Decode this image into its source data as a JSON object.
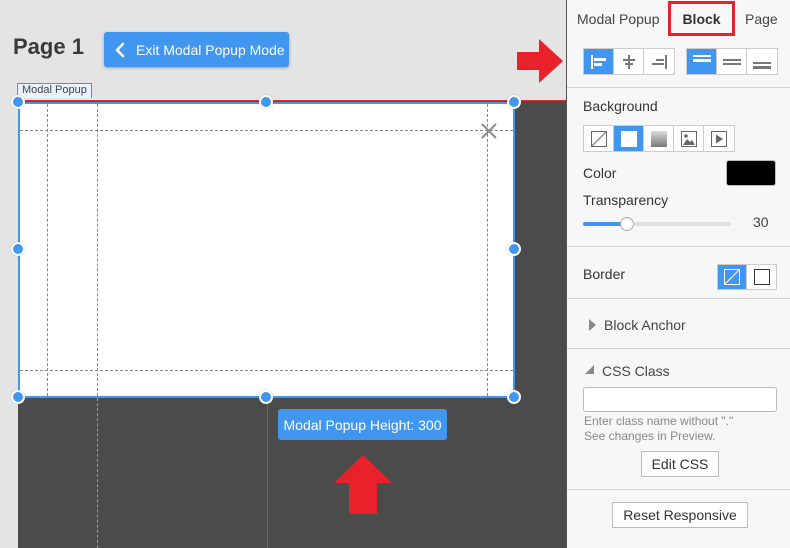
{
  "canvas": {
    "page_title": "Page 1",
    "exit_button_label": "Exit Modal Popup Mode",
    "modal_label": "Modal Popup",
    "height_tooltip": "Modal Popup Height: 300"
  },
  "panel": {
    "tabs": [
      {
        "label": "Modal Popup",
        "active": false
      },
      {
        "label": "Block",
        "active": true
      },
      {
        "label": "Page",
        "active": false
      }
    ],
    "horizontal_align": {
      "options": [
        "align-left-icon",
        "align-center-icon",
        "align-right-icon"
      ],
      "selected": "align-left-icon"
    },
    "vertical_align": {
      "options": [
        "align-top-icon",
        "align-middle-icon",
        "align-bottom-icon"
      ],
      "selected": "align-top-icon"
    },
    "background": {
      "label": "Background",
      "options": [
        "none-icon",
        "solid-color-icon",
        "gradient-icon",
        "image-icon",
        "video-icon"
      ],
      "selected": "solid-color-icon",
      "color_label": "Color",
      "color_value": "#000000",
      "transparency_label": "Transparency",
      "transparency_value": 30
    },
    "border": {
      "label": "Border",
      "options": [
        "no-border-icon",
        "border-box-icon"
      ],
      "selected": "no-border-icon"
    },
    "block_anchor": {
      "label": "Block Anchor",
      "expanded": false
    },
    "css_class": {
      "label": "CSS Class",
      "expanded": true,
      "input_value": "",
      "help_line1": "Enter class name without \".\"",
      "help_line2": "See changes in Preview.",
      "edit_button": "Edit CSS"
    },
    "reset_button": "Reset Responsive"
  },
  "colors": {
    "accent": "#4196f0",
    "annotation_red": "#e8212a",
    "page_dark": "#4b4b4b",
    "canvas_bg": "#e4e4e4",
    "panel_bg": "#f7f7f7"
  }
}
